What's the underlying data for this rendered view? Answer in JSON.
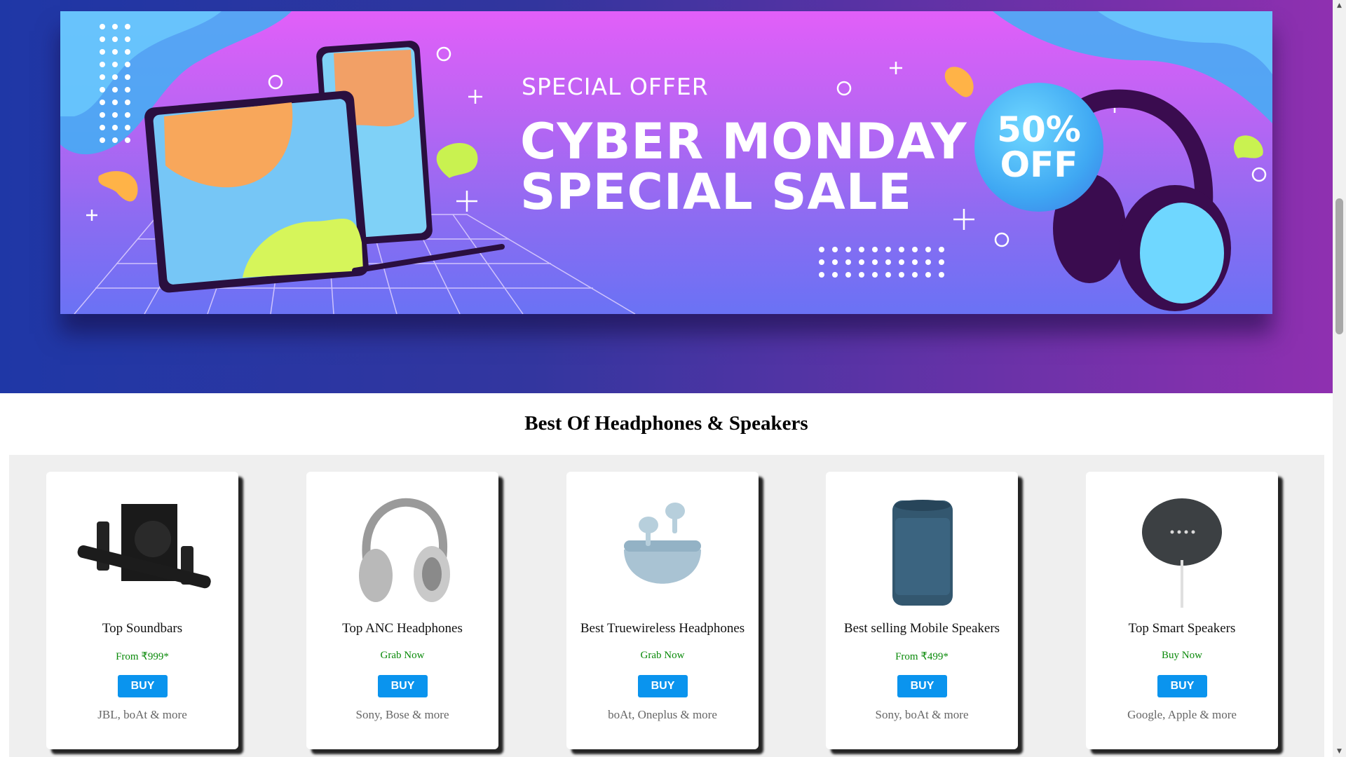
{
  "banner": {
    "subtitle": "SPECIAL OFFER",
    "headline_line1": "CYBER MONDAY",
    "headline_line2": "SPECIAL SALE",
    "badge_line1": "50%",
    "badge_line2": "OFF",
    "illustration_icons": [
      "tablet-icon",
      "phone-icon",
      "stylus-icon",
      "headphones-icon"
    ]
  },
  "section": {
    "title": "Best Of Headphones & Speakers"
  },
  "products": [
    {
      "name": "Top Soundbars",
      "price": "From ₹999*",
      "button": "BUY",
      "brands": "JBL, boAt & more",
      "icon": "soundbar-icon"
    },
    {
      "name": "Top ANC Headphones",
      "price": "Grab Now",
      "button": "BUY",
      "brands": "Sony, Bose & more",
      "icon": "headphones-icon"
    },
    {
      "name": "Best Truewireless Headphones",
      "price": "Grab Now",
      "button": "BUY",
      "brands": "boAt, Oneplus & more",
      "icon": "earbuds-icon"
    },
    {
      "name": "Best selling Mobile Speakers",
      "price": "From ₹499*",
      "button": "BUY",
      "brands": "Sony, boAt & more",
      "icon": "speaker-icon"
    },
    {
      "name": "Top Smart Speakers",
      "price": "Buy Now",
      "button": "BUY",
      "brands": "Google, Apple & more",
      "icon": "smart-speaker-icon"
    }
  ],
  "colors": {
    "buy_button": "#0a94ee",
    "price_text": "#0a8a0a",
    "brand_text": "#666666"
  },
  "scrollbar": {
    "up_icon": "chevron-up-icon",
    "down_icon": "chevron-down-icon"
  }
}
